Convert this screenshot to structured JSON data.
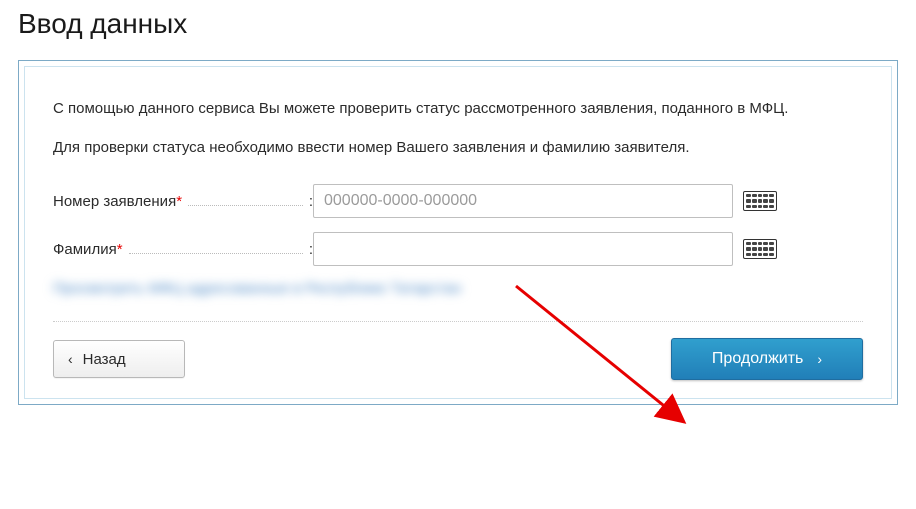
{
  "title": "Ввод данных",
  "intro": "С помощью данного сервиса Вы можете проверить статус рассмотренного заявления, поданного в МФЦ.",
  "instruction": "Для проверки статуса необходимо ввести номер Вашего заявления и фамилию заявителя.",
  "fields": {
    "appnum": {
      "label": "Номер заявления",
      "placeholder": "000000-0000-000000",
      "value": ""
    },
    "surname": {
      "label": "Фамилия",
      "placeholder": "",
      "value": ""
    }
  },
  "blurred_text": "Просмотреть МФЦ адресованные в Республике Татарстан",
  "buttons": {
    "back": "Назад",
    "continue": "Продолжить"
  },
  "symbols": {
    "asterisk": "*",
    "colon": ":",
    "chev_left": "‹",
    "chev_right": "›"
  }
}
